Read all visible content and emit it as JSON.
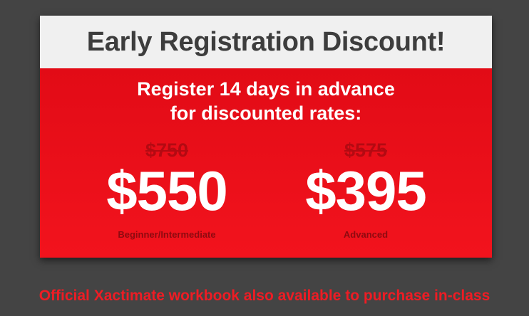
{
  "banner": {
    "title": "Early Registration Discount!",
    "intro_line1": "Register 14 days in advance",
    "intro_line2": "for discounted rates:"
  },
  "prices": [
    {
      "original": "$750",
      "discounted": "$550",
      "tier": "Beginner/Intermediate"
    },
    {
      "original": "$575",
      "discounted": "$395",
      "tier": "Advanced"
    }
  ],
  "footer": {
    "note": "Official Xactimate workbook also available to purchase in-class"
  },
  "colors": {
    "background": "#444444",
    "header_bg": "#f0f0f0",
    "title_text": "#3d3d3d",
    "body_red": "#ee1c24",
    "strike_red": "#b30a12",
    "tier_text": "#8e0a10",
    "footer_text": "#ee1c24"
  }
}
